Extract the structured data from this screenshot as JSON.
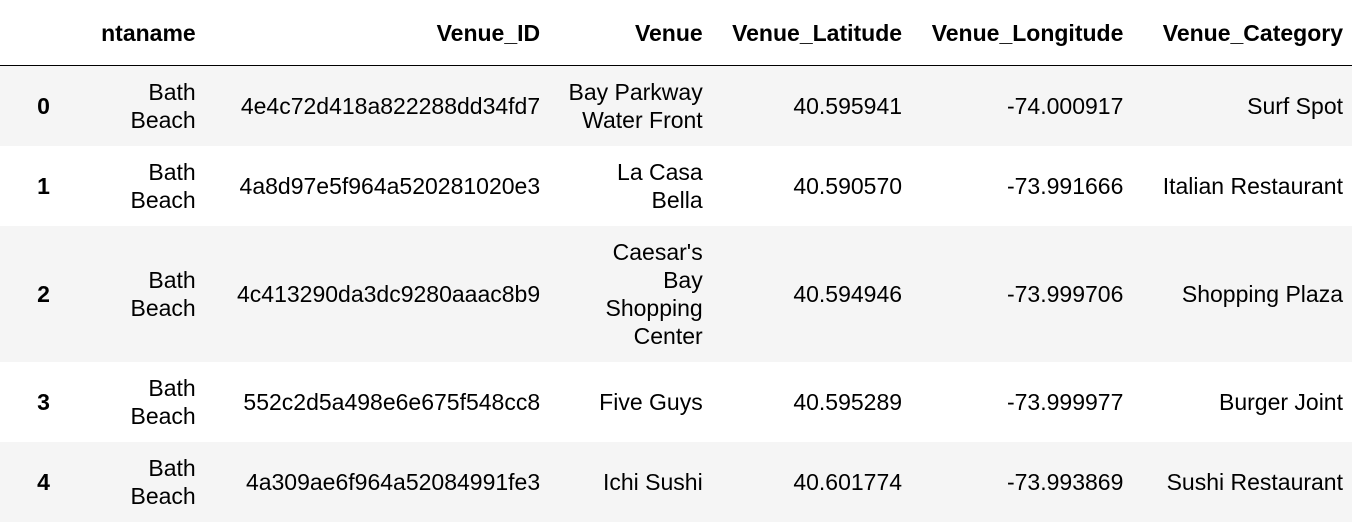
{
  "columns": [
    "",
    "ntaname",
    "Venue_ID",
    "Venue",
    "Venue_Latitude",
    "Venue_Longitude",
    "Venue_Category"
  ],
  "rows": [
    {
      "index": "0",
      "ntaname": "Bath\nBeach",
      "venue_id": "4e4c72d418a822288dd34fd7",
      "venue": "Bay Parkway\nWater Front",
      "lat": "40.595941",
      "lon": "-74.000917",
      "category": "Surf Spot"
    },
    {
      "index": "1",
      "ntaname": "Bath\nBeach",
      "venue_id": "4a8d97e5f964a520281020e3",
      "venue": "La Casa\nBella",
      "lat": "40.590570",
      "lon": "-73.991666",
      "category": "Italian Restaurant"
    },
    {
      "index": "2",
      "ntaname": "Bath\nBeach",
      "venue_id": "4c413290da3dc9280aaac8b9",
      "venue": "Caesar's\nBay\nShopping\nCenter",
      "lat": "40.594946",
      "lon": "-73.999706",
      "category": "Shopping Plaza"
    },
    {
      "index": "3",
      "ntaname": "Bath\nBeach",
      "venue_id": "552c2d5a498e6e675f548cc8",
      "venue": "Five Guys",
      "lat": "40.595289",
      "lon": "-73.999977",
      "category": "Burger Joint"
    },
    {
      "index": "4",
      "ntaname": "Bath\nBeach",
      "venue_id": "4a309ae6f964a52084991fe3",
      "venue": "Ichi Sushi",
      "lat": "40.601774",
      "lon": "-73.993869",
      "category": "Sushi Restaurant"
    }
  ]
}
